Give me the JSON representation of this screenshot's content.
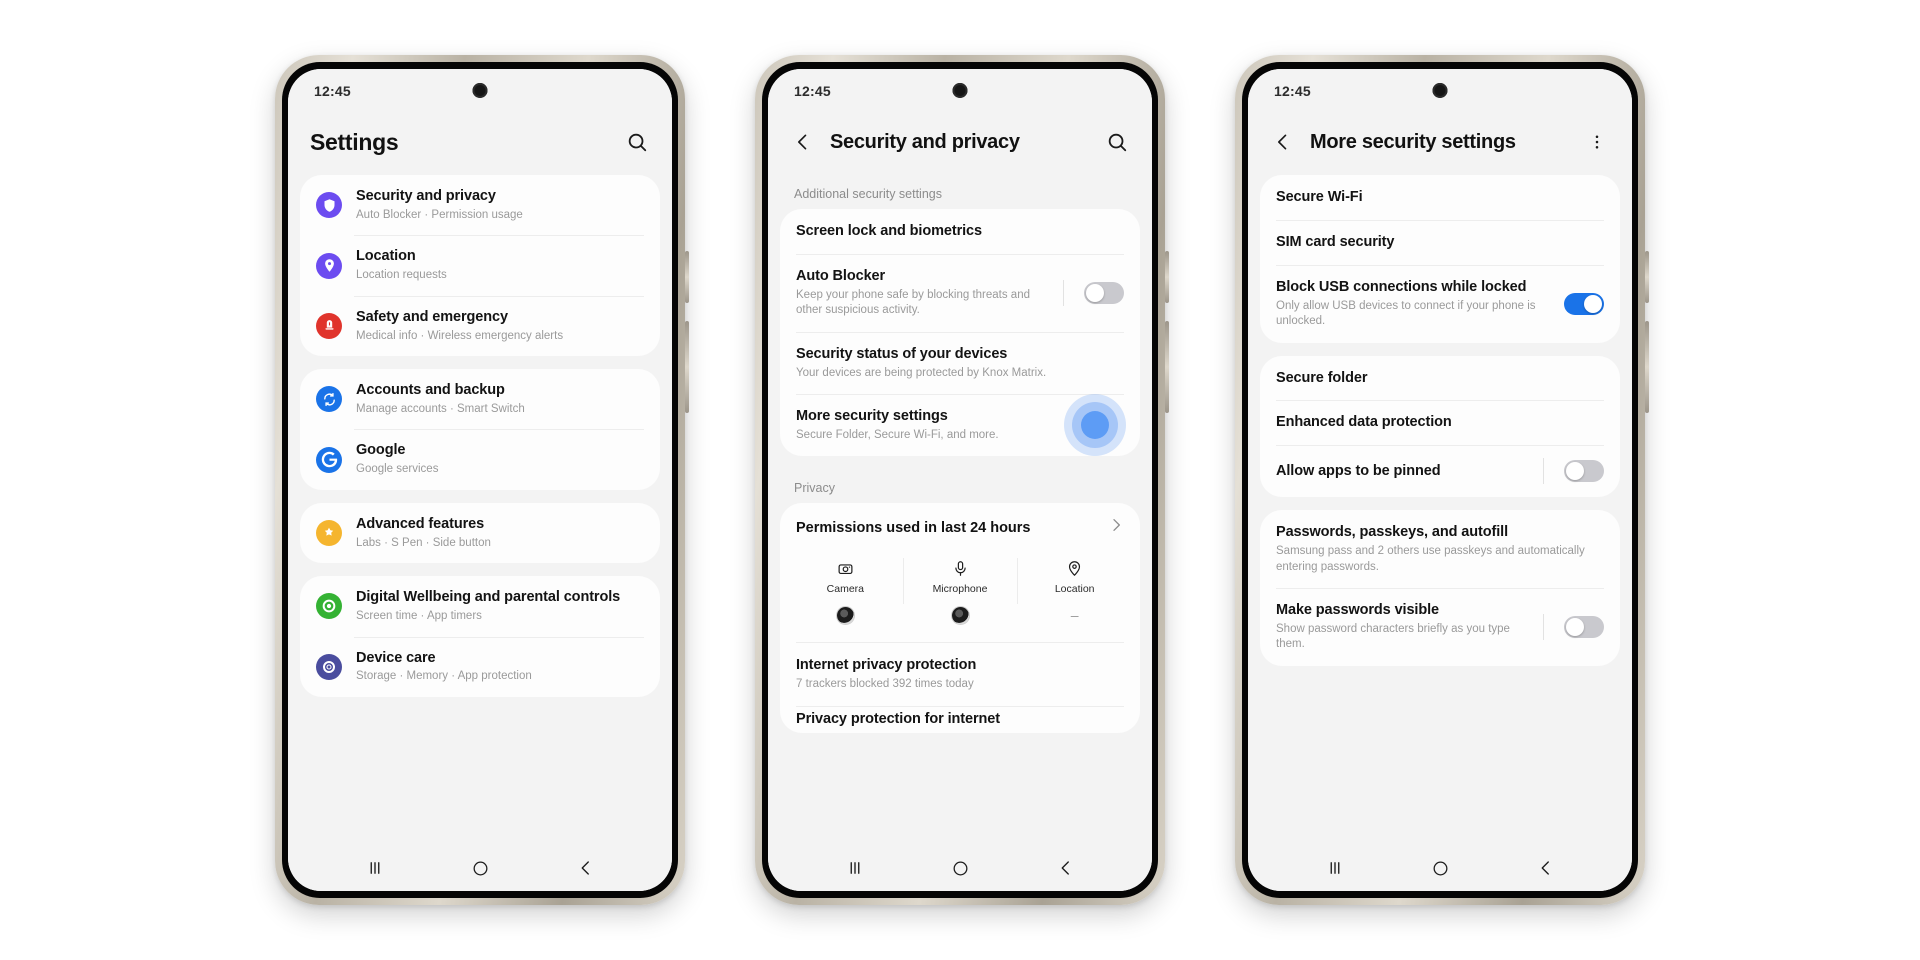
{
  "meta": {
    "status_time": "12:45"
  },
  "phone1": {
    "header": {
      "title": "Settings",
      "search_icon": "search-icon"
    },
    "groups": [
      {
        "items": [
          {
            "title": "Security and privacy",
            "sub": "Auto Blocker  ·  Permission usage",
            "icon": "shield-icon",
            "color": "purple"
          },
          {
            "title": "Location",
            "sub": "Location requests",
            "icon": "location-pin-icon",
            "color": "violet"
          },
          {
            "title": "Safety and emergency",
            "sub": "Medical info  ·  Wireless emergency alerts",
            "icon": "emergency-icon",
            "color": "red"
          }
        ]
      },
      {
        "items": [
          {
            "title": "Accounts and backup",
            "sub": "Manage accounts  ·  Smart Switch",
            "icon": "sync-icon",
            "color": "blue"
          },
          {
            "title": "Google",
            "sub": "Google services",
            "icon": "google-g-icon",
            "color": "white-g"
          }
        ]
      },
      {
        "items": [
          {
            "title": "Advanced features",
            "sub": "Labs  ·  S Pen  ·  Side button",
            "icon": "advanced-features-icon",
            "color": "amber"
          }
        ]
      },
      {
        "items": [
          {
            "title": "Digital Wellbeing and parental controls",
            "sub": "Screen time  ·  App timers",
            "icon": "wellbeing-icon",
            "color": "green"
          },
          {
            "title": "Device care",
            "sub": "Storage  ·  Memory  ·  App protection",
            "icon": "device-care-icon",
            "color": "indigo"
          }
        ]
      }
    ]
  },
  "phone2": {
    "header": {
      "back_icon": "back-chevron-icon",
      "title": "Security and privacy",
      "search_icon": "search-icon"
    },
    "section_label": "Additional security settings",
    "items": [
      {
        "title": "Screen lock and biometrics",
        "sub": "",
        "control": "none"
      },
      {
        "title": "Auto Blocker",
        "sub": "Keep your phone safe by blocking threats and other suspicious activity.",
        "control": "toggle",
        "toggle_state": "off"
      },
      {
        "title": "Security status of your devices",
        "sub": "Your devices are being protected by Knox Matrix.",
        "control": "none"
      },
      {
        "title": "More security settings",
        "sub": "Secure Folder, Secure Wi-Fi, and more.",
        "control": "tap-indicator"
      }
    ],
    "privacy_label": "Privacy",
    "permissions": {
      "title": "Permissions used in last 24 hours",
      "chevron_icon": "chevron-right-icon",
      "cells": [
        {
          "name": "Camera",
          "icon": "camera-icon",
          "app": "dot"
        },
        {
          "name": "Microphone",
          "icon": "microphone-icon",
          "app": "dot"
        },
        {
          "name": "Location",
          "icon": "location-pin-outline-icon",
          "app": "dash",
          "dash": "–"
        }
      ]
    },
    "internet": {
      "title": "Internet privacy protection",
      "sub": "7 trackers blocked 392 times today"
    },
    "clipped_row": "Privacy protection for internet"
  },
  "phone3": {
    "header": {
      "back_icon": "back-chevron-icon",
      "title": "More security settings",
      "menu_icon": "kebab-menu-icon"
    },
    "groups": [
      {
        "items": [
          {
            "title": "Secure Wi-Fi",
            "sub": "",
            "control": "none"
          },
          {
            "title": "SIM card security",
            "sub": "",
            "control": "none"
          },
          {
            "title": "Block USB connections while locked",
            "sub": "Only allow USB devices to connect if your phone is unlocked.",
            "control": "toggle",
            "toggle_state": "on"
          }
        ]
      },
      {
        "items": [
          {
            "title": "Secure folder",
            "sub": "",
            "control": "none"
          },
          {
            "title": "Enhanced data protection",
            "sub": "",
            "control": "none"
          },
          {
            "title": "Allow apps to be pinned",
            "sub": "",
            "control": "toggle",
            "toggle_state": "off"
          }
        ]
      },
      {
        "items": [
          {
            "title": "Passwords, passkeys, and autofill",
            "sub": "Samsung pass and 2 others use passkeys and automatically entering passwords.",
            "control": "none"
          },
          {
            "title": "Make passwords visible",
            "sub": "Show password characters briefly as you type them.",
            "control": "toggle",
            "toggle_state": "off"
          }
        ]
      }
    ]
  },
  "navbar": {
    "recents_icon": "recents-icon",
    "home_icon": "home-icon",
    "back_icon": "back-icon"
  },
  "colors": {
    "accent_blue": "#1a73e8",
    "purple": "#6c4cf0",
    "red": "#e0342c",
    "amber": "#f5b52e",
    "green": "#34b233",
    "indigo": "#4a4d9e",
    "toggle_off": "#8e8e93",
    "screen_bg": "#f3f3f3",
    "card_bg": "#fdfdfd"
  }
}
